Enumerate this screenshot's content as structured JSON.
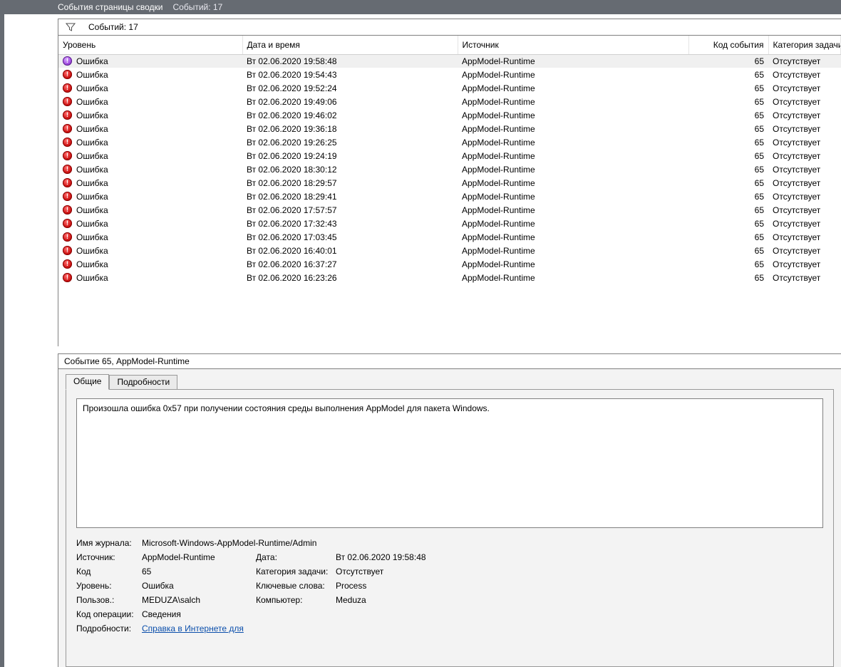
{
  "titlebar": {
    "text1": "События страницы сводки",
    "text2": "Событий: 17"
  },
  "filter": {
    "count_label": "Событий: 17"
  },
  "columns": {
    "level": "Уровень",
    "datetime": "Дата и время",
    "source": "Источник",
    "code": "Код события",
    "task": "Категория задачи"
  },
  "rows": [
    {
      "sel": true,
      "level": "Ошибка",
      "dt": "Вт 02.06.2020 19:58:48",
      "src": "AppModel-Runtime",
      "code": "65",
      "task": "Отсутствует"
    },
    {
      "sel": false,
      "level": "Ошибка",
      "dt": "Вт 02.06.2020 19:54:43",
      "src": "AppModel-Runtime",
      "code": "65",
      "task": "Отсутствует"
    },
    {
      "sel": false,
      "level": "Ошибка",
      "dt": "Вт 02.06.2020 19:52:24",
      "src": "AppModel-Runtime",
      "code": "65",
      "task": "Отсутствует"
    },
    {
      "sel": false,
      "level": "Ошибка",
      "dt": "Вт 02.06.2020 19:49:06",
      "src": "AppModel-Runtime",
      "code": "65",
      "task": "Отсутствует"
    },
    {
      "sel": false,
      "level": "Ошибка",
      "dt": "Вт 02.06.2020 19:46:02",
      "src": "AppModel-Runtime",
      "code": "65",
      "task": "Отсутствует"
    },
    {
      "sel": false,
      "level": "Ошибка",
      "dt": "Вт 02.06.2020 19:36:18",
      "src": "AppModel-Runtime",
      "code": "65",
      "task": "Отсутствует"
    },
    {
      "sel": false,
      "level": "Ошибка",
      "dt": "Вт 02.06.2020 19:26:25",
      "src": "AppModel-Runtime",
      "code": "65",
      "task": "Отсутствует"
    },
    {
      "sel": false,
      "level": "Ошибка",
      "dt": "Вт 02.06.2020 19:24:19",
      "src": "AppModel-Runtime",
      "code": "65",
      "task": "Отсутствует"
    },
    {
      "sel": false,
      "level": "Ошибка",
      "dt": "Вт 02.06.2020 18:30:12",
      "src": "AppModel-Runtime",
      "code": "65",
      "task": "Отсутствует"
    },
    {
      "sel": false,
      "level": "Ошибка",
      "dt": "Вт 02.06.2020 18:29:57",
      "src": "AppModel-Runtime",
      "code": "65",
      "task": "Отсутствует"
    },
    {
      "sel": false,
      "level": "Ошибка",
      "dt": "Вт 02.06.2020 18:29:41",
      "src": "AppModel-Runtime",
      "code": "65",
      "task": "Отсутствует"
    },
    {
      "sel": false,
      "level": "Ошибка",
      "dt": "Вт 02.06.2020 17:57:57",
      "src": "AppModel-Runtime",
      "code": "65",
      "task": "Отсутствует"
    },
    {
      "sel": false,
      "level": "Ошибка",
      "dt": "Вт 02.06.2020 17:32:43",
      "src": "AppModel-Runtime",
      "code": "65",
      "task": "Отсутствует"
    },
    {
      "sel": false,
      "level": "Ошибка",
      "dt": "Вт 02.06.2020 17:03:45",
      "src": "AppModel-Runtime",
      "code": "65",
      "task": "Отсутствует"
    },
    {
      "sel": false,
      "level": "Ошибка",
      "dt": "Вт 02.06.2020 16:40:01",
      "src": "AppModel-Runtime",
      "code": "65",
      "task": "Отсутствует"
    },
    {
      "sel": false,
      "level": "Ошибка",
      "dt": "Вт 02.06.2020 16:37:27",
      "src": "AppModel-Runtime",
      "code": "65",
      "task": "Отсутствует"
    },
    {
      "sel": false,
      "level": "Ошибка",
      "dt": "Вт 02.06.2020 16:23:26",
      "src": "AppModel-Runtime",
      "code": "65",
      "task": "Отсутствует"
    }
  ],
  "detail": {
    "heading": "Событие 65, AppModel-Runtime",
    "tab_general": "Общие",
    "tab_details": "Подробности",
    "message": "Произошла ошибка 0x57 при получении состояния среды выполнения AppModel для пакета Windows.",
    "labels": {
      "logname": "Имя журнала:",
      "source": "Источник:",
      "code": "Код",
      "level": "Уровень:",
      "user": "Пользов.:",
      "opcode": "Код операции:",
      "moreinfo": "Подробности:",
      "date": "Дата:",
      "taskcat": "Категория задачи:",
      "keywords": "Ключевые слова:",
      "computer": "Компьютер:"
    },
    "values": {
      "logname": "Microsoft-Windows-AppModel-Runtime/Admin",
      "source": "AppModel-Runtime",
      "code": "65",
      "level": "Ошибка",
      "user": "MEDUZA\\salch",
      "opcode": "Сведения",
      "moreinfo_link": "Справка в Интернете для ",
      "date": "Вт 02.06.2020 19:58:48",
      "taskcat": "Отсутствует",
      "keywords": "Process",
      "computer": "Meduza"
    }
  }
}
